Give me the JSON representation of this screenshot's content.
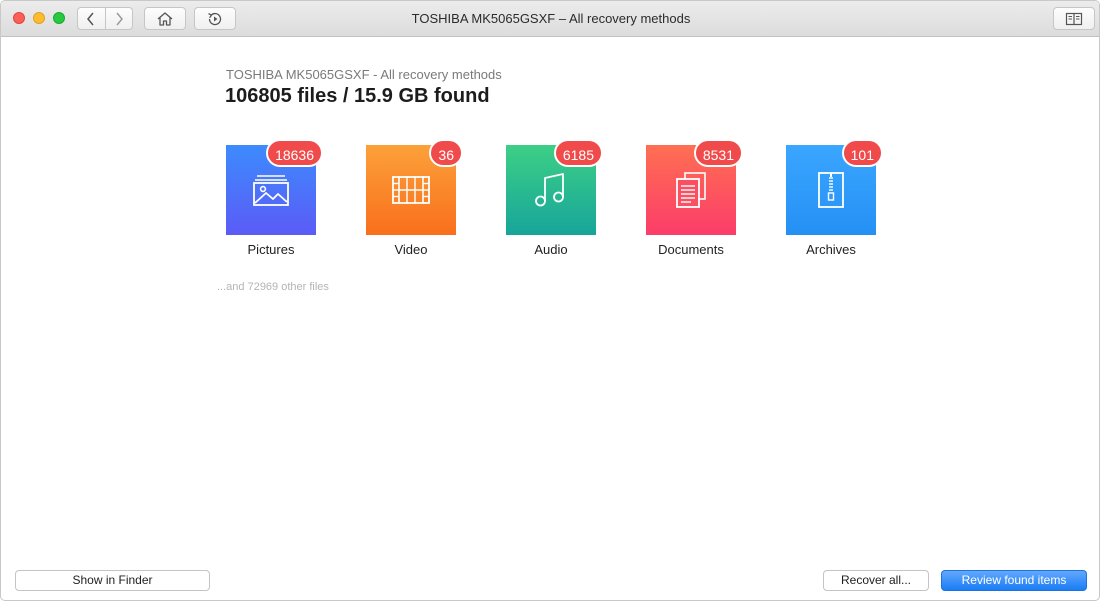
{
  "window": {
    "title": "TOSHIBA MK5065GSXF – All recovery methods"
  },
  "toolbar": {
    "back_icon": "chevron-left-icon",
    "forward_icon": "chevron-right-icon",
    "home_icon": "home-icon",
    "history_icon": "history-icon",
    "sidebar_icon": "book-icon"
  },
  "summary": {
    "subtitle": "TOSHIBA MK5065GSXF - All recovery methods",
    "headline": "106805 files / 15.9 GB found"
  },
  "categories": [
    {
      "label": "Pictures",
      "count": "18636",
      "icon": "picture-icon",
      "color_from": "#3d8bfd",
      "color_to": "#5b5bf6"
    },
    {
      "label": "Video",
      "count": "36",
      "icon": "film-icon",
      "color_from": "#fca13a",
      "color_to": "#f96f1c"
    },
    {
      "label": "Audio",
      "count": "6185",
      "icon": "music-note-icon",
      "color_from": "#3dcf86",
      "color_to": "#17a59a"
    },
    {
      "label": "Documents",
      "count": "8531",
      "icon": "document-icon",
      "color_from": "#ff6f52",
      "color_to": "#fb3d6a"
    },
    {
      "label": "Archives",
      "count": "101",
      "icon": "zip-icon",
      "color_from": "#3aa6ff",
      "color_to": "#2590f4"
    }
  ],
  "other_files": "...and 72969 other files",
  "footer": {
    "show_in_finder": "Show in Finder",
    "recover_all": "Recover all...",
    "review_found": "Review found items"
  },
  "colors": {
    "badge": "#f04a4a",
    "accent": "#1a7cf5"
  }
}
